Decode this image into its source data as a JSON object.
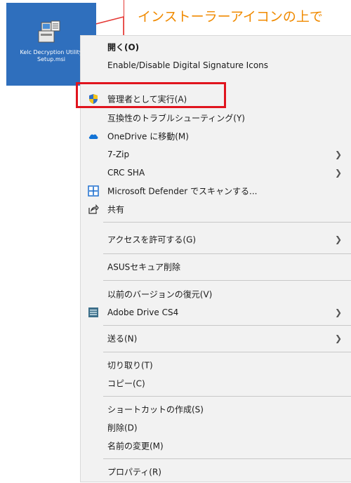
{
  "file": {
    "name": "Kelc Decryption Utility Setup.msi",
    "icon": "msi-installer-icon",
    "tile_color": "#2f6fbd"
  },
  "callout": {
    "text": "インストーラーアイコンの上で",
    "text_color": "#f08a00",
    "border_color": "#e53935"
  },
  "menu": {
    "items": [
      {
        "label": "開く(O)",
        "icon": ""
      },
      {
        "label": "Enable/Disable Digital Signature Icons",
        "icon": ""
      },
      {
        "label": "管理者として実行(A)",
        "icon": "uac-shield-icon",
        "highlighted": true
      },
      {
        "label": "互換性のトラブルシューティング(Y)",
        "icon": ""
      },
      {
        "label": "OneDrive に移動(M)",
        "icon": "onedrive-cloud-icon"
      },
      {
        "label": "7-Zip",
        "icon": "",
        "submenu": true
      },
      {
        "label": "CRC SHA",
        "icon": "",
        "submenu": true
      },
      {
        "label": "Microsoft Defender でスキャンする...",
        "icon": "defender-icon"
      },
      {
        "label": "共有",
        "icon": "share-icon"
      },
      {
        "label": "アクセスを許可する(G)",
        "icon": "",
        "submenu": true
      },
      {
        "label": "ASUSセキュア削除",
        "icon": ""
      },
      {
        "label": "以前のバージョンの復元(V)",
        "icon": ""
      },
      {
        "label": "Adobe Drive CS4",
        "icon": "adobe-drive-icon",
        "submenu": true
      },
      {
        "label": "送る(N)",
        "icon": "",
        "submenu": true
      },
      {
        "label": "切り取り(T)",
        "icon": ""
      },
      {
        "label": "コピー(C)",
        "icon": ""
      },
      {
        "label": "ショートカットの作成(S)",
        "icon": ""
      },
      {
        "label": "削除(D)",
        "icon": ""
      },
      {
        "label": "名前の変更(M)",
        "icon": ""
      },
      {
        "label": "プロパティ(R)",
        "icon": ""
      }
    ],
    "highlight_color": "#e0141e"
  }
}
